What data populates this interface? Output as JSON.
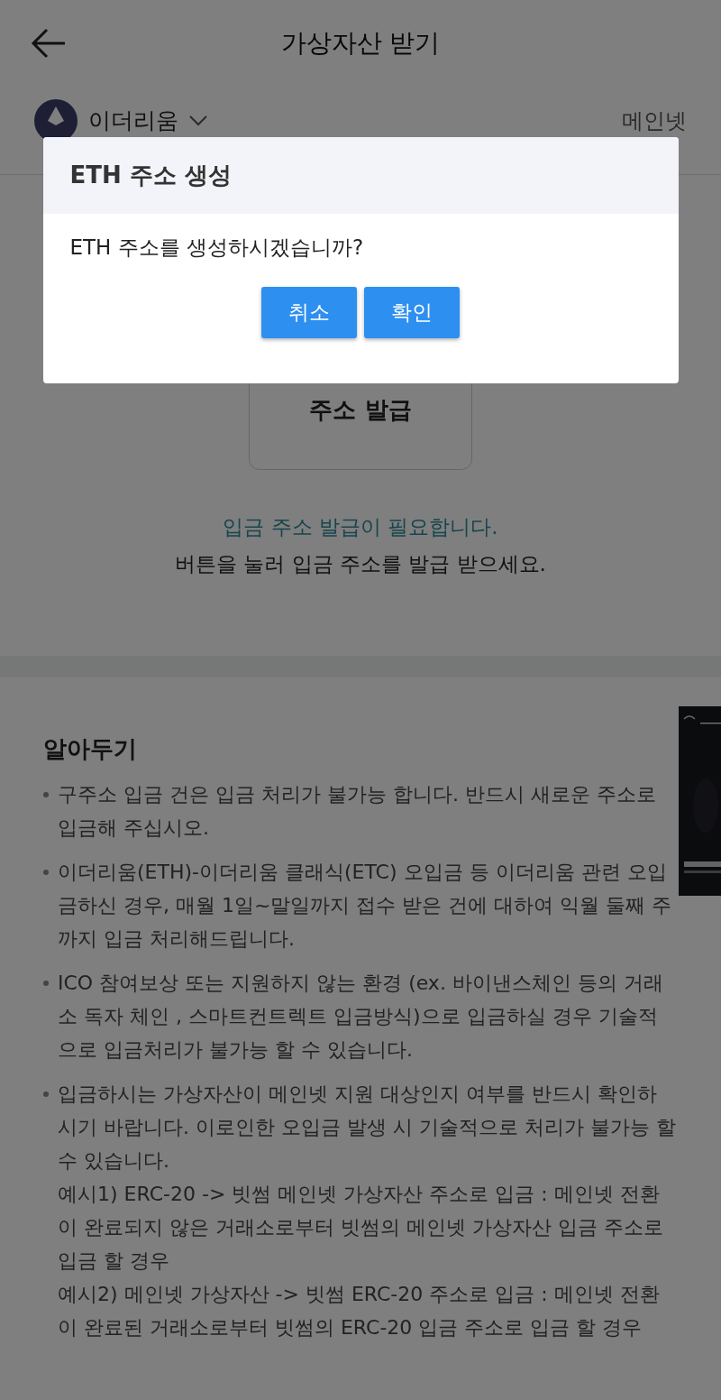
{
  "header": {
    "title": "가상자산 받기"
  },
  "coin": {
    "name": "이더리움",
    "network": "메인넷"
  },
  "issue_button": {
    "label": "주소 발급"
  },
  "notice": {
    "highlight": "입금 주소 발급이 필요합니다.",
    "text": "버튼을 눌러 입금 주소를 발급 받으세요."
  },
  "notes": {
    "title": "알아두기",
    "items": [
      {
        "text": "구주소 입금 건은 입금 처리가 불가능 합니다. 반드시 새로운 주소로 입금해 주십시오."
      },
      {
        "text": "이더리움(ETH)-이더리움 클래식(ETC) 오입금 등 이더리움 관련 오입금하신 경우, 매월 1일~말일까지 접수 받은 건에 대하여 익월 둘째 주까지 입금 처리해드립니다."
      },
      {
        "text": "ICO 참여보상 또는 지원하지 않는 환경 (ex. 바이낸스체인 등의 거래소 독자 체인 , 스마트컨트렉트 입금방식)으로 입금하실 경우 기술적으로 입금처리가 불가능 할 수 있습니다."
      },
      {
        "text": "입금하시는 가상자산이 메인넷 지원 대상인지 여부를 반드시 확인하시기 바랍니다. 이로인한 오입금 발생 시 기술적으로 처리가 불가능 할 수 있습니다.",
        "examples": [
          "예시1) ERC-20 -> 빗썸 메인넷 가상자산 주소로 입금 : 메인넷 전환이 완료되지 않은 거래소로부터 빗썸의 메인넷 가상자산 입금 주소로 입금 할 경우",
          "예시2) 메인넷 가상자산 -> 빗썸 ERC-20 주소로 입금 : 메인넷 전환이 완료된 거래소로부터 빗썸의 ERC-20 입금 주소로 입금 할 경우"
        ]
      }
    ]
  },
  "dialog": {
    "title": "ETH 주소 생성",
    "message": "ETH 주소를 생성하시겠습니까?",
    "buttons": [
      "취소",
      "확인"
    ]
  }
}
